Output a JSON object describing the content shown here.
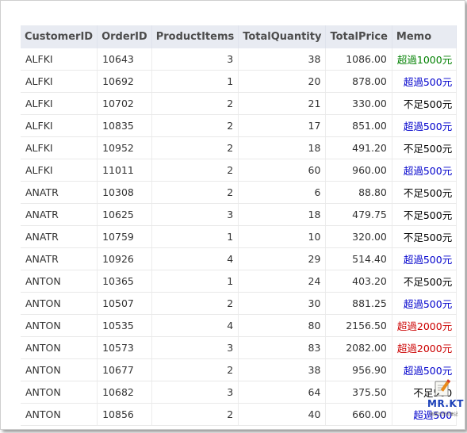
{
  "table": {
    "headers": [
      "CustomerID",
      "OrderID",
      "ProductItems",
      "TotalQuantity",
      "TotalPrice",
      "Memo"
    ],
    "rows": [
      {
        "customer": "ALFKI",
        "order": "10643",
        "items": "3",
        "qty": "38",
        "price": "1086.00",
        "memo": "超過1000元",
        "memo_color": "#008000"
      },
      {
        "customer": "ALFKI",
        "order": "10692",
        "items": "1",
        "qty": "20",
        "price": "878.00",
        "memo": "超過500元",
        "memo_color": "#0000cc"
      },
      {
        "customer": "ALFKI",
        "order": "10702",
        "items": "2",
        "qty": "21",
        "price": "330.00",
        "memo": "不足500元",
        "memo_color": "#000000"
      },
      {
        "customer": "ALFKI",
        "order": "10835",
        "items": "2",
        "qty": "17",
        "price": "851.00",
        "memo": "超過500元",
        "memo_color": "#0000cc"
      },
      {
        "customer": "ALFKI",
        "order": "10952",
        "items": "2",
        "qty": "18",
        "price": "491.20",
        "memo": "不足500元",
        "memo_color": "#000000"
      },
      {
        "customer": "ALFKI",
        "order": "11011",
        "items": "2",
        "qty": "60",
        "price": "960.00",
        "memo": "超過500元",
        "memo_color": "#0000cc"
      },
      {
        "customer": "ANATR",
        "order": "10308",
        "items": "2",
        "qty": "6",
        "price": "88.80",
        "memo": "不足500元",
        "memo_color": "#000000"
      },
      {
        "customer": "ANATR",
        "order": "10625",
        "items": "3",
        "qty": "18",
        "price": "479.75",
        "memo": "不足500元",
        "memo_color": "#000000"
      },
      {
        "customer": "ANATR",
        "order": "10759",
        "items": "1",
        "qty": "10",
        "price": "320.00",
        "memo": "不足500元",
        "memo_color": "#000000"
      },
      {
        "customer": "ANATR",
        "order": "10926",
        "items": "4",
        "qty": "29",
        "price": "514.40",
        "memo": "超過500元",
        "memo_color": "#0000cc"
      },
      {
        "customer": "ANTON",
        "order": "10365",
        "items": "1",
        "qty": "24",
        "price": "403.20",
        "memo": "不足500元",
        "memo_color": "#000000"
      },
      {
        "customer": "ANTON",
        "order": "10507",
        "items": "2",
        "qty": "30",
        "price": "881.25",
        "memo": "超過500元",
        "memo_color": "#0000cc"
      },
      {
        "customer": "ANTON",
        "order": "10535",
        "items": "4",
        "qty": "80",
        "price": "2156.50",
        "memo": "超過2000元",
        "memo_color": "#cc0000"
      },
      {
        "customer": "ANTON",
        "order": "10573",
        "items": "3",
        "qty": "83",
        "price": "2082.00",
        "memo": "超過2000元",
        "memo_color": "#cc0000"
      },
      {
        "customer": "ANTON",
        "order": "10677",
        "items": "2",
        "qty": "38",
        "price": "956.90",
        "memo": "超過500元",
        "memo_color": "#0000cc"
      },
      {
        "customer": "ANTON",
        "order": "10682",
        "items": "3",
        "qty": "64",
        "price": "375.50",
        "memo": "不足500",
        "memo_color": "#000000"
      },
      {
        "customer": "ANTON",
        "order": "10856",
        "items": "2",
        "qty": "40",
        "price": "660.00",
        "memo": "超過500",
        "memo_color": "#0000cc"
      }
    ]
  },
  "logo": {
    "title": "MR.KT",
    "subtitle": "新舊式學習筆記",
    "icon": "notepad-pencil-icon"
  }
}
